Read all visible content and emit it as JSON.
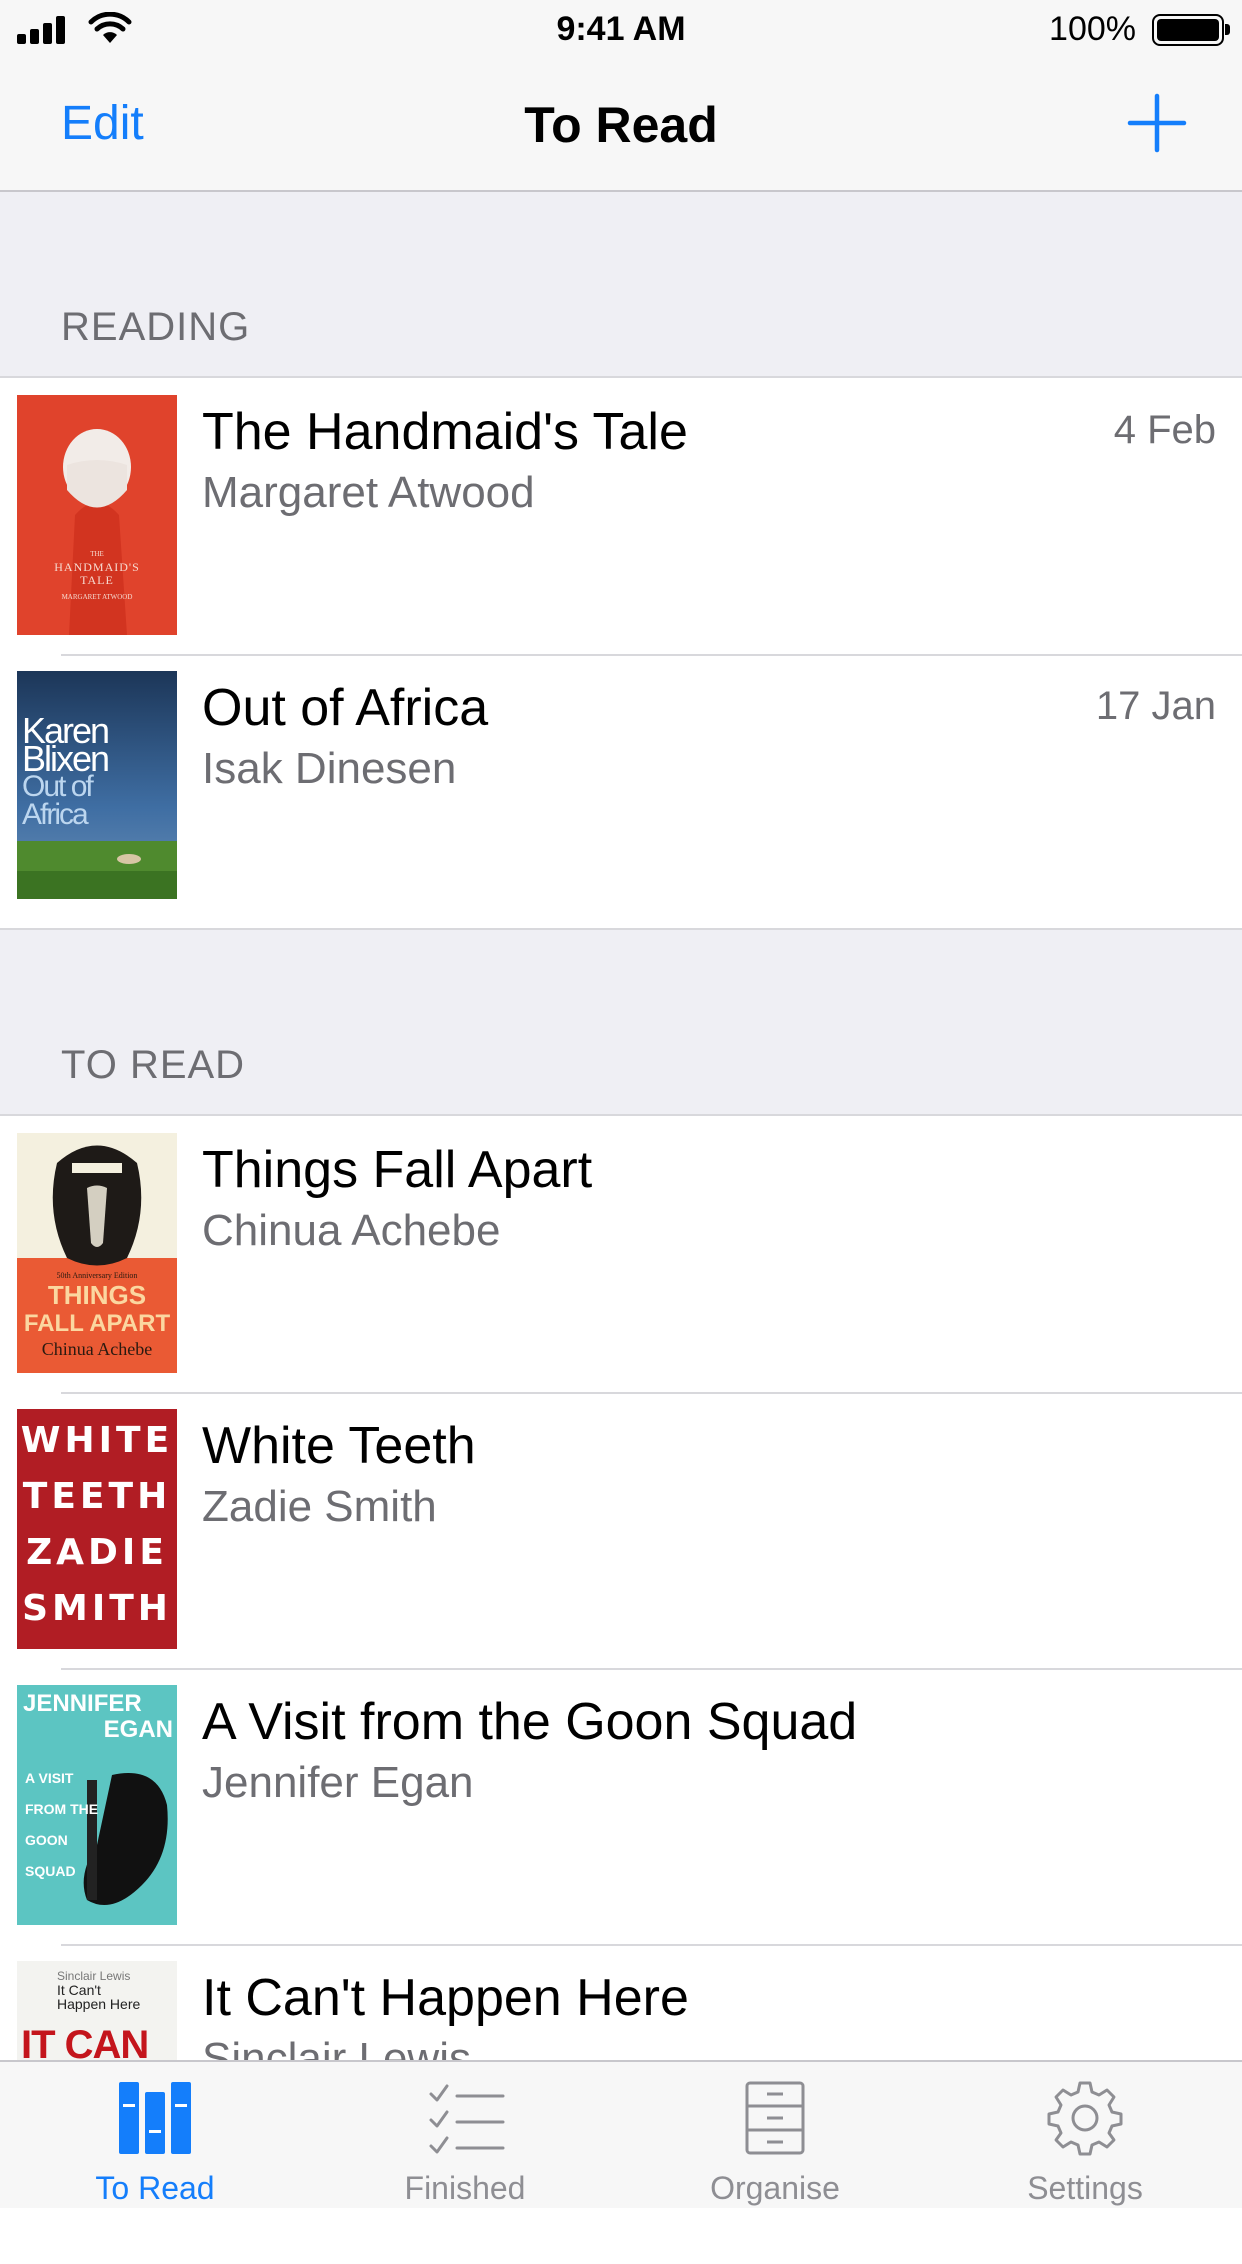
{
  "status_bar": {
    "time": "9:41 AM",
    "battery": "100%"
  },
  "nav": {
    "edit_label": "Edit",
    "title": "To Read"
  },
  "sections": [
    {
      "title": "READING",
      "books": [
        {
          "title": "The Handmaid's Tale",
          "author": "Margaret Atwood",
          "date": "4 Feb",
          "cover_text": [
            "THE",
            "HANDMAID'S",
            "TALE",
            "MARGARET ATWOOD"
          ]
        },
        {
          "title": "Out of Africa",
          "author": "Isak Dinesen",
          "date": "17 Jan",
          "cover_text": [
            "Karen",
            "Blixen",
            "Out of",
            "Africa"
          ]
        }
      ]
    },
    {
      "title": "TO READ",
      "books": [
        {
          "title": "Things Fall Apart",
          "author": "Chinua Achebe",
          "cover_text": [
            "50th Anniversary Edition",
            "THINGS",
            "FALL APART",
            "Chinua Achebe"
          ]
        },
        {
          "title": "White Teeth",
          "author": "Zadie Smith",
          "cover_text": [
            "WHITE",
            "TEETH",
            "ZADIE",
            "SMITH"
          ]
        },
        {
          "title": "A Visit from the Goon Squad",
          "author": "Jennifer Egan",
          "cover_text": [
            "JENNIFER",
            "EGAN",
            "A VISIT",
            "FROM THE",
            "GOON",
            "SQUAD"
          ]
        },
        {
          "title": "It Can't Happen Here",
          "author": "Sinclair Lewis",
          "cover_text": [
            "Sinclair Lewis",
            "It Can't",
            "Happen Here",
            "IT CAN"
          ]
        }
      ]
    }
  ],
  "tabs": [
    {
      "label": "To Read",
      "icon": "books-icon",
      "active": true
    },
    {
      "label": "Finished",
      "icon": "checklist-icon",
      "active": false
    },
    {
      "label": "Organise",
      "icon": "cabinet-icon",
      "active": false
    },
    {
      "label": "Settings",
      "icon": "gear-icon",
      "active": false
    }
  ],
  "colors": {
    "accent": "#147efb",
    "secondary_text": "#6d6d72",
    "tab_inactive": "#8e8e93"
  }
}
